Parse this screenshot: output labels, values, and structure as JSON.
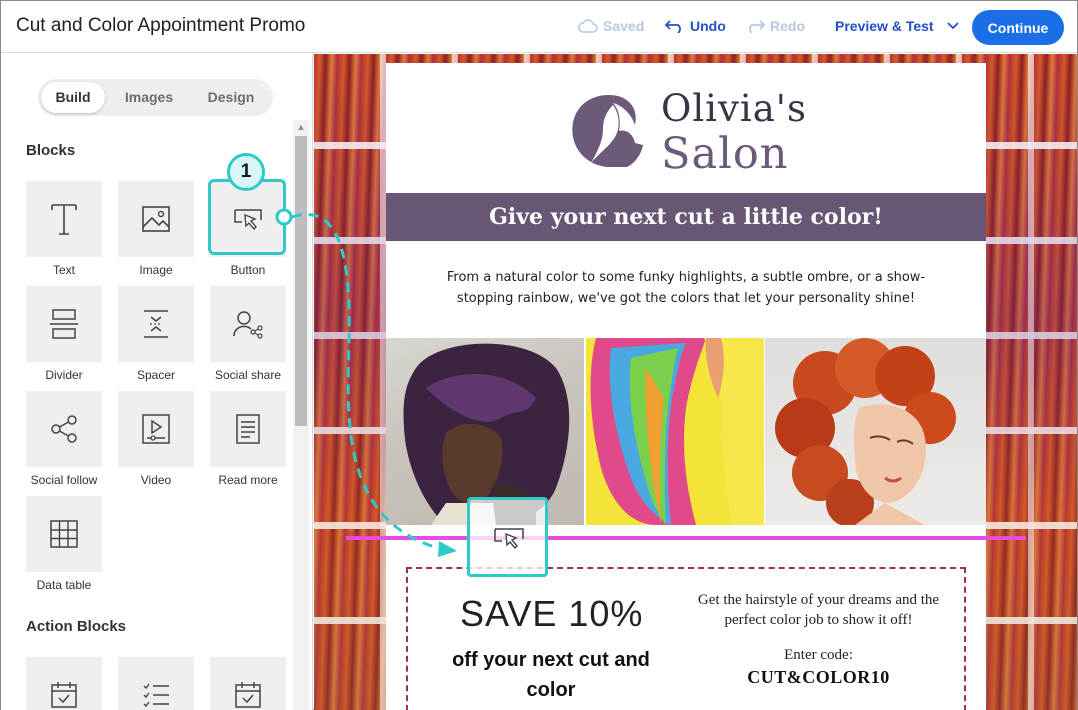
{
  "topbar": {
    "title": "Cut and Color Appointment Promo",
    "saved": "Saved",
    "undo": "Undo",
    "redo": "Redo",
    "preview": "Preview & Test",
    "continue": "Continue"
  },
  "tabs": [
    "Build",
    "Images",
    "Design"
  ],
  "sections": {
    "blocks": "Blocks",
    "action_blocks": "Action Blocks"
  },
  "blocks": [
    {
      "label": "Text",
      "icon": "text-icon"
    },
    {
      "label": "Image",
      "icon": "image-icon"
    },
    {
      "label": "Button",
      "icon": "button-cursor-icon"
    },
    {
      "label": "Divider",
      "icon": "divider-icon"
    },
    {
      "label": "Spacer",
      "icon": "spacer-icon"
    },
    {
      "label": "Social share",
      "icon": "social-share-icon"
    },
    {
      "label": "Social follow",
      "icon": "social-follow-icon"
    },
    {
      "label": "Video",
      "icon": "video-icon"
    },
    {
      "label": "Read more",
      "icon": "read-more-icon"
    },
    {
      "label": "Data table",
      "icon": "data-table-icon"
    }
  ],
  "callout": {
    "step": "1"
  },
  "email": {
    "logo_line1": "Olivia's",
    "logo_line2": "Salon",
    "banner": "Give your next cut a little color!",
    "intro": "From a natural color to some funky highlights, a subtle ombre, or a show-stopping rainbow, we've got the colors that let your personality shine!",
    "save_big": "SAVE 10%",
    "save_sub": "off your next cut and color",
    "promo_text": "Get the hairstyle of your dreams and the perfect color job to show it off!",
    "code_label": "Enter code:",
    "code": "CUT&COLOR10"
  },
  "colors": {
    "accent": "#1b6fe6",
    "link": "#2350c9",
    "banner": "#675774",
    "callout": "#2ecac9",
    "drop_line": "#e84be0"
  }
}
